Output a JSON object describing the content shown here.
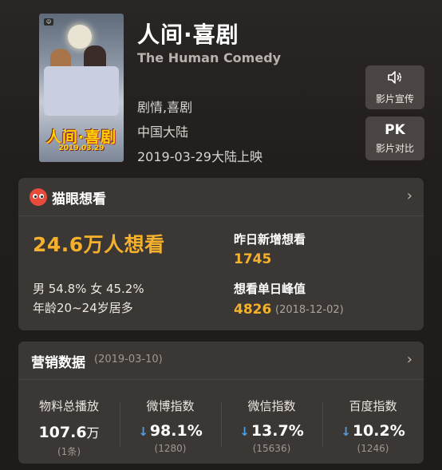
{
  "movie": {
    "title": "人间·喜剧",
    "english_title": "The Human Comedy",
    "genre": "剧情,喜剧",
    "region": "中国大陆",
    "release": "2019-03-29大陆上映",
    "poster_title": "人间·喜剧",
    "poster_date": "2019.03.29"
  },
  "side_buttons": {
    "promo_label": "影片宣传",
    "promo_icon": "speaker-icon",
    "pk_label": "影片对比",
    "pk_icon_text": "PK"
  },
  "want": {
    "header": "猫眼想看",
    "total": "24.6万人想看",
    "gender": "男 54.8%   女 45.2%",
    "age": "年龄20~24岁居多",
    "yesterday_label": "昨日新增想看",
    "yesterday_value": "1745",
    "peak_label": "想看单日峰值",
    "peak_value": "4826",
    "peak_date": "(2018-12-02)"
  },
  "marketing": {
    "header": "营销数据",
    "date": "(2019-03-10)",
    "columns": [
      {
        "label": "物料总播放",
        "value": "107.6",
        "unit": "万",
        "sub": "(1条)",
        "down": false
      },
      {
        "label": "微博指数",
        "value": "98.1%",
        "unit": "",
        "sub": "(1280)",
        "down": true
      },
      {
        "label": "微信指数",
        "value": "13.7%",
        "unit": "",
        "sub": "(15636)",
        "down": true
      },
      {
        "label": "百度指数",
        "value": "10.2%",
        "unit": "",
        "sub": "(1246)",
        "down": true
      }
    ]
  },
  "icons": {
    "chevron": "chevron-right-icon",
    "arrow": "down-arrow-icon"
  },
  "colors": {
    "accent": "#f6b12c",
    "down_arrow": "#4a9ee8",
    "card_bg": "#3b3735",
    "brand_red": "#e84b3c"
  }
}
